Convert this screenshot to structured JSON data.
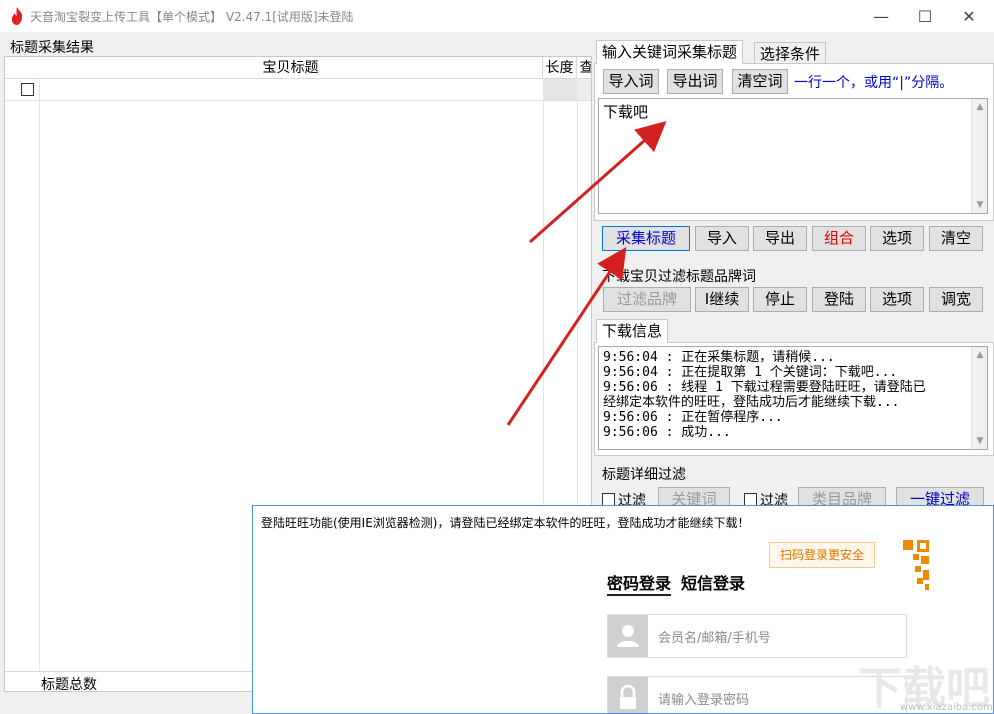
{
  "window": {
    "title": "天音淘宝裂变上传工具【单个模式】 V2.47.1[试用版]未登陆",
    "minimize_glyph": "—",
    "maximize_glyph": "☐",
    "close_glyph": "✕"
  },
  "left": {
    "group_label": "标题采集结果",
    "columns": [
      "宝贝标题",
      "长度",
      "查"
    ],
    "footer_label": "标题总数"
  },
  "tabs": [
    "输入关键词采集标题",
    "选择条件"
  ],
  "keyword_toolbar": {
    "import_label": "导入词",
    "export_label": "导出词",
    "clear_label": "清空词",
    "hint": "一行一个，或用“|”分隔。"
  },
  "keyword_text": "下载吧",
  "action_buttons": {
    "collect": "采集标题",
    "import": "导入",
    "export": "导出",
    "combine": "组合",
    "options": "选项",
    "clear": "清空"
  },
  "brand_filter": {
    "label": "下载宝贝过滤标题品牌词",
    "filter_brand": "过滤品牌",
    "continue": "I继续",
    "stop": "停止",
    "login": "登陆",
    "options": "选项",
    "widen": "调宽"
  },
  "download_info": {
    "tab": "下载信息",
    "log": "9:56:04 : 正在采集标题，请稍候...\n9:56:04 : 正在提取第 1 个关键词：下载吧...\n9:56:06 : 线程 1 下载过程需要登陆旺旺，请登陆已\n经绑定本软件的旺旺，登陆成功后才能继续下载...\n9:56:06 : 正在暂停程序...\n9:56:06 : 成功..."
  },
  "detail_filter": {
    "label": "标题详细过滤",
    "filter1": "过滤",
    "keyword_btn": "关键词",
    "filter2": "过滤",
    "category_btn": "类目品牌",
    "one_key": "一键过滤"
  },
  "login_popup": {
    "message": "登陆旺旺功能(使用IE浏览器检测)，请登陆已经绑定本软件的旺旺，登陆成功才能继续下载！",
    "qr_tip": "扫码登录更安全",
    "tab_password": "密码登录",
    "tab_sms": "短信登录",
    "username_placeholder": "会员名/邮箱/手机号",
    "password_placeholder": "请输入登录密码"
  },
  "watermark": {
    "text": "下载吧",
    "sub": "www.xiazaiba.com"
  },
  "colors": {
    "arrow": "#d42020",
    "hint_blue": "#0000dd",
    "combine_red": "#e00000",
    "popup_border": "#4a90d9"
  },
  "icons": [
    "flame-icon",
    "user-icon",
    "lock-icon",
    "qr-code-icon"
  ]
}
